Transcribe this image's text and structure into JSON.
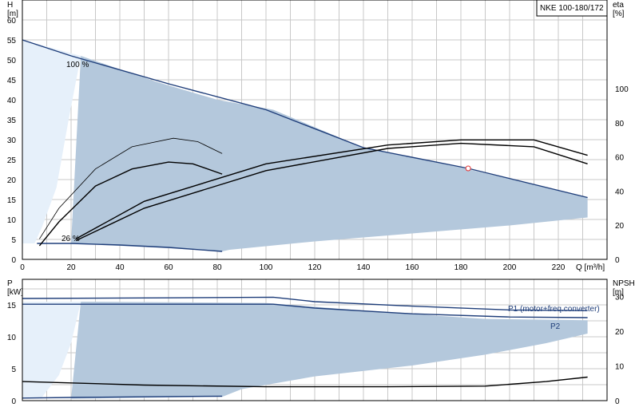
{
  "chart_data": [
    {
      "type": "line",
      "title": "NKE 100-180/172",
      "xlabel": "Q [m³/h]",
      "ylabel": "H\n[m]",
      "y2label": "eta\n[%]",
      "xlim": [
        0,
        240
      ],
      "ylim": [
        0,
        65
      ],
      "y2lim": [
        0,
        152
      ],
      "xticks": [
        0,
        20,
        40,
        60,
        80,
        100,
        120,
        140,
        160,
        180,
        200,
        220
      ],
      "yticks": [
        0,
        5,
        10,
        15,
        20,
        25,
        30,
        35,
        40,
        45,
        50,
        55,
        60
      ],
      "y2ticks": [
        0,
        20,
        40,
        60,
        80,
        100
      ],
      "grid": true,
      "annotations": [
        {
          "text": "100 %",
          "x": 19,
          "y": 51.5
        },
        {
          "text": "26 %",
          "x": 17,
          "y": 5.5
        }
      ],
      "operating_point": {
        "x": 183,
        "y": 22.8,
        "color": "#e03030"
      },
      "series": [
        {
          "role": "operating-area",
          "color": "#b4c8dc",
          "x": [
            24,
            55,
            80,
            103,
            140,
            180,
            215,
            232,
            232,
            200,
            160,
            120,
            85,
            82,
            60,
            40,
            20
          ],
          "y": [
            51,
            44.5,
            40,
            37.5,
            28,
            23,
            18,
            15.5,
            10.5,
            8.5,
            6.5,
            4.5,
            2.4,
            2,
            2.8,
            3.4,
            4
          ]
        },
        {
          "role": "min-speed-area",
          "color": "#e6f0fa",
          "x": [
            0,
            24,
            19,
            14,
            8,
            5,
            0
          ],
          "y": [
            55,
            51,
            35,
            18,
            8,
            4,
            4
          ]
        },
        {
          "role": "head-max",
          "color": "#1f3e7a",
          "x": [
            0,
            20,
            60,
            100,
            140,
            183,
            232
          ],
          "y": [
            55,
            51,
            44,
            37.5,
            28,
            22.8,
            15.5
          ]
        },
        {
          "role": "head-min",
          "color": "#1f3e7a",
          "x": [
            6,
            20,
            40,
            60,
            82
          ],
          "y": [
            4,
            4,
            3.6,
            3,
            2
          ]
        },
        {
          "role": "eta-upper",
          "axis": "y2",
          "color": "#000000",
          "x": [
            7,
            15,
            30,
            45,
            62,
            72,
            82
          ],
          "y": [
            12,
            30,
            53,
            66,
            71,
            69,
            62
          ]
        },
        {
          "role": "eta-lower",
          "axis": "y2",
          "color": "#000000",
          "x": [
            7,
            15,
            30,
            45,
            60,
            70,
            82
          ],
          "y": [
            8,
            22,
            43,
            53,
            57,
            56,
            50
          ]
        },
        {
          "role": "eta-mid",
          "axis": "y2",
          "color": "#000000",
          "x": [
            22,
            50,
            100,
            150,
            180,
            210,
            232
          ],
          "y": [
            11,
            30,
            52,
            65,
            68,
            66,
            56
          ]
        },
        {
          "role": "eta-main",
          "axis": "y2",
          "color": "#000000",
          "x": [
            22,
            50,
            100,
            150,
            180,
            210,
            232
          ],
          "y": [
            12,
            34,
            56,
            67,
            70,
            70,
            61
          ]
        }
      ]
    },
    {
      "type": "line",
      "xlim": [
        0,
        240
      ],
      "ylim": [
        0,
        19
      ],
      "y2lim": [
        0,
        35
      ],
      "ylabel": "P\n[kW]",
      "y2label": "NPSH\n[m]",
      "yticks": [
        0,
        5,
        10,
        15
      ],
      "y2ticks": [
        0,
        10,
        20,
        30
      ],
      "grid": true,
      "labels": [
        {
          "text": "P1 (motor+freq.converter)",
          "color": "#1f3e7a"
        },
        {
          "text": "P2",
          "color": "#1f3e7a"
        }
      ],
      "series": [
        {
          "role": "power-area",
          "color": "#b4c8dc",
          "x": [
            24,
            100,
            150,
            190,
            232,
            232,
            215,
            190,
            160,
            120,
            90,
            82,
            60,
            40,
            20
          ],
          "y": [
            15.5,
            15.3,
            13.8,
            12.8,
            12.6,
            10.5,
            9,
            7.2,
            5.5,
            3.8,
            1.8,
            0.6,
            0.5,
            0.4,
            0.3
          ]
        },
        {
          "role": "min-speed-area",
          "color": "#e6f0fa",
          "x": [
            0,
            24,
            20,
            15,
            8,
            0
          ],
          "y": [
            15.5,
            15.5,
            9,
            4,
            0.5,
            0.3
          ]
        },
        {
          "name": "P1 (motor+freq.converter)",
          "color": "#1f3e7a",
          "x": [
            0,
            60,
            103,
            120,
            160,
            200,
            232
          ],
          "y": [
            16,
            16.1,
            16.2,
            15.5,
            14.8,
            14.2,
            14.1
          ]
        },
        {
          "name": "P2",
          "color": "#1f3e7a",
          "x": [
            0,
            60,
            103,
            120,
            160,
            200,
            232
          ],
          "y": [
            15.1,
            15.1,
            15.1,
            14.5,
            13.6,
            13.1,
            13
          ]
        },
        {
          "role": "power-min",
          "color": "#1f3e7a",
          "x": [
            0,
            20,
            50,
            82
          ],
          "y": [
            0.4,
            0.5,
            0.6,
            0.7
          ]
        },
        {
          "role": "npsh",
          "axis": "y2",
          "color": "#000000",
          "x": [
            0,
            50,
            100,
            150,
            190,
            215,
            232
          ],
          "y": [
            5.5,
            4.5,
            4,
            4,
            4.2,
            5.5,
            6.8
          ]
        }
      ]
    }
  ]
}
